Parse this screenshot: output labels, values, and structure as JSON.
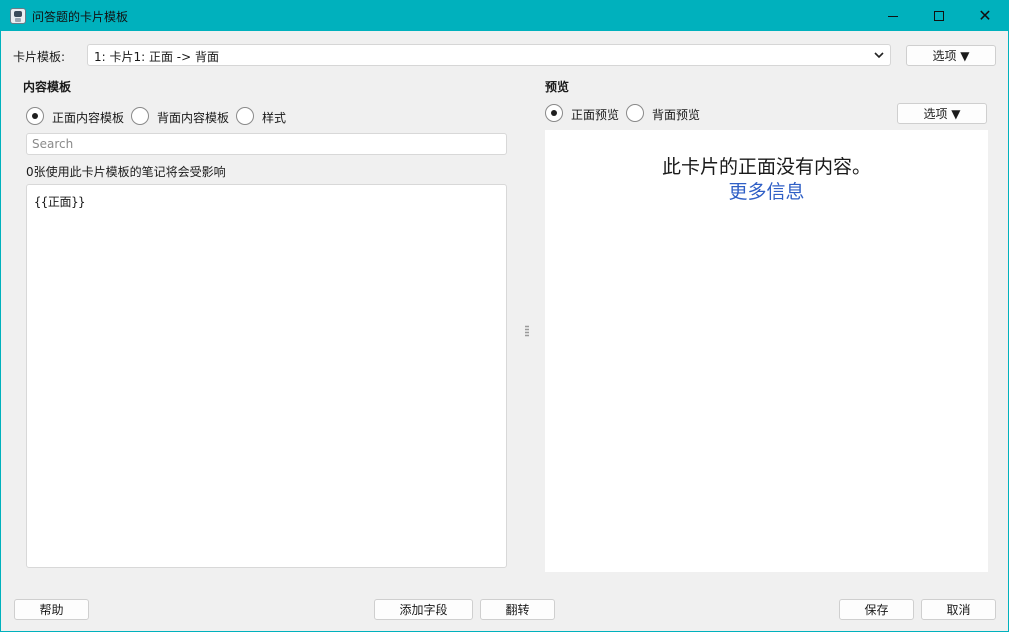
{
  "window": {
    "title": "问答题的卡片模板",
    "minimize": "—",
    "maximize": "☐",
    "close": "✕"
  },
  "card_type": {
    "label": "卡片模板:",
    "selected": "1: 卡片1: 正面 -> 背面",
    "options_button": "选项 ▼"
  },
  "left": {
    "heading": "内容模板",
    "radios": [
      {
        "label": "正面内容模板",
        "checked": true
      },
      {
        "label": "背面内容模板",
        "checked": false
      },
      {
        "label": "样式",
        "checked": false
      }
    ],
    "search_placeholder": "Search",
    "affected_notes": "0张使用此卡片模板的笔记将会受影响",
    "editor_text": "{{正面}}"
  },
  "right": {
    "heading": "预览",
    "radios": [
      {
        "label": "正面预览",
        "checked": true
      },
      {
        "label": "背面预览",
        "checked": false
      }
    ],
    "options_button": "选项 ▼",
    "preview_message": "此卡片的正面没有内容。",
    "preview_link": "更多信息"
  },
  "footer": {
    "help": "帮助",
    "add_field": "添加字段",
    "flip": "翻转",
    "save": "保存",
    "cancel": "取消"
  },
  "colors": {
    "titlebar": "#00b1bd",
    "link": "#2f5fc6"
  }
}
